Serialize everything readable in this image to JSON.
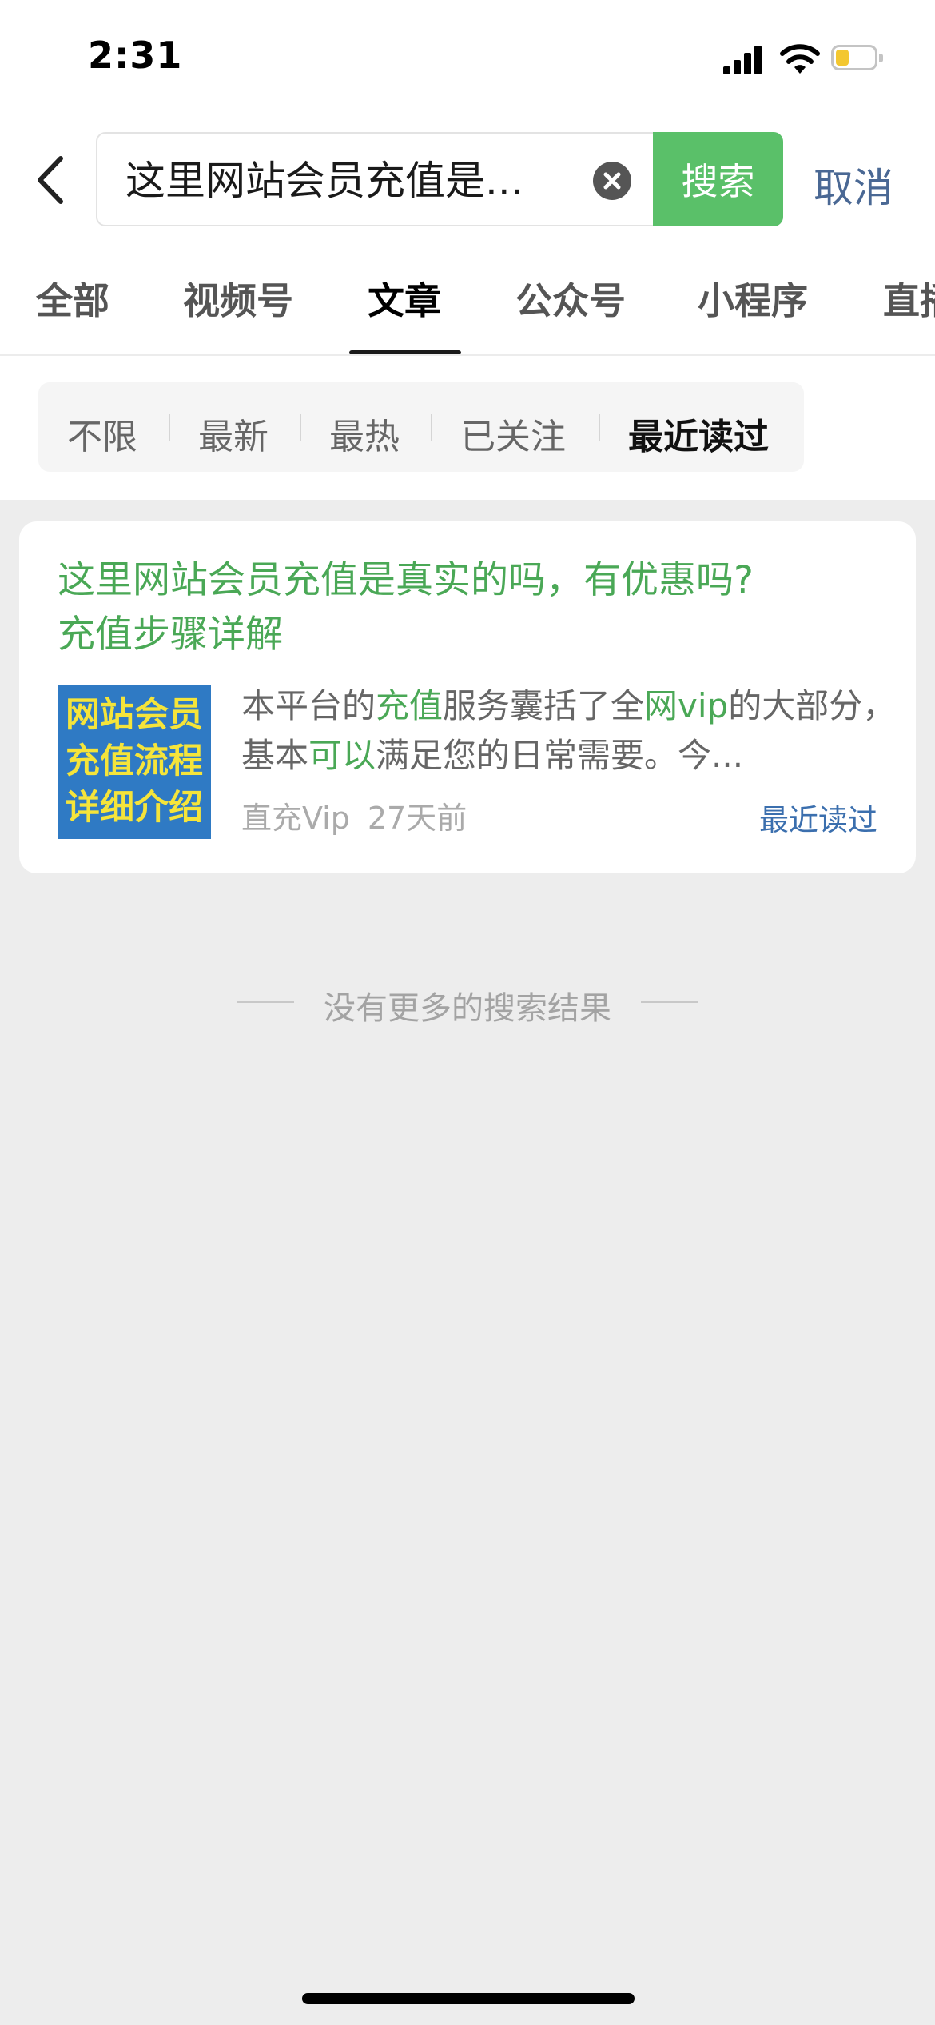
{
  "status_bar": {
    "time": "2:31",
    "battery_color": "#f3c730"
  },
  "search": {
    "query": "这里网站会员充值是...",
    "button_label": "搜索",
    "cancel_label": "取消",
    "accent_color": "#5ac069"
  },
  "tabs": [
    {
      "label": "全部"
    },
    {
      "label": "视频号"
    },
    {
      "label": "文章",
      "active": true
    },
    {
      "label": "公众号"
    },
    {
      "label": "小程序"
    },
    {
      "label": "直播"
    }
  ],
  "filters": [
    {
      "label": "不限"
    },
    {
      "label": "最新"
    },
    {
      "label": "最热"
    },
    {
      "label": "已关注"
    },
    {
      "label": "最近读过",
      "active": true
    }
  ],
  "result": {
    "title_line1": "这里网站会员充值是真实的吗，有优惠吗?",
    "title_line2": "充值步骤详解",
    "thumbnail_lines": [
      "网站会员",
      "充值流程",
      "详细介绍"
    ],
    "snippet_parts": [
      "本平台的",
      "充值",
      "服务囊括了全",
      "网vip",
      "的大部分，基本",
      "可以",
      "满足您的日常需要。今..."
    ],
    "source": "直充Vip",
    "time_ago": "27天前",
    "tag": "最近读过"
  },
  "end_message": "没有更多的搜索结果"
}
